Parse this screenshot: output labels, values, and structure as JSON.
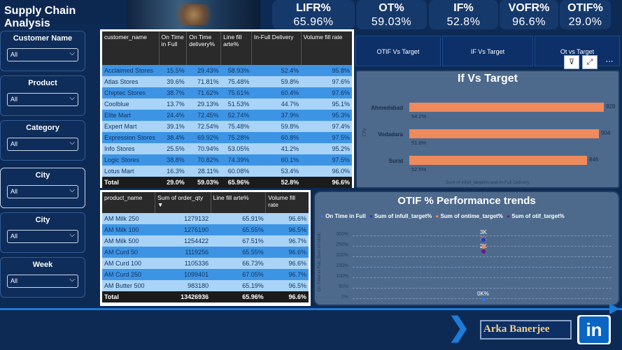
{
  "header": {
    "title": "Supply Chain Analysis"
  },
  "kpis": [
    {
      "label": "LIFR%",
      "value": "65.96%"
    },
    {
      "label": "OT%",
      "value": "59.03%"
    },
    {
      "label": "IF%",
      "value": "52.8%"
    },
    {
      "label": "VOFR%",
      "value": "96.6%"
    },
    {
      "label": "OTIF%",
      "value": "29.0%"
    }
  ],
  "slicers": [
    {
      "label": "Customer Name",
      "value": "All"
    },
    {
      "label": "Product",
      "value": "All"
    },
    {
      "label": "Category",
      "value": "All"
    },
    {
      "label": "City",
      "value": "All"
    },
    {
      "label": "City",
      "value": "All"
    },
    {
      "label": "Week",
      "value": "All"
    }
  ],
  "customer_table": {
    "headers": [
      "customer_name",
      "On Time in Full",
      "On Time delivery%",
      "Line fill arte%",
      "In-Full Delivery",
      "Volume fill rate"
    ],
    "rows": [
      [
        "Acclaimed Stores",
        "15.5%",
        "29.43%",
        "58.93%",
        "52.4%",
        "95.8%"
      ],
      [
        "Atlas Stores",
        "39.6%",
        "71.81%",
        "75.48%",
        "59.8%",
        "97.6%"
      ],
      [
        "Chiptec Stores",
        "38.7%",
        "71.62%",
        "75.61%",
        "60.4%",
        "97.6%"
      ],
      [
        "Coolblue",
        "13.7%",
        "29.13%",
        "51.53%",
        "44.7%",
        "95.1%"
      ],
      [
        "Elite Mart",
        "24.4%",
        "72.45%",
        "52.74%",
        "37.9%",
        "95.3%"
      ],
      [
        "Expert Mart",
        "39.1%",
        "72.54%",
        "75.48%",
        "59.8%",
        "97.4%"
      ],
      [
        "Expression Stores",
        "38.4%",
        "69.92%",
        "75.28%",
        "60.8%",
        "97.5%"
      ],
      [
        "Info Stores",
        "25.5%",
        "70.94%",
        "53.05%",
        "41.2%",
        "95.2%"
      ],
      [
        "Logic Stores",
        "38.8%",
        "70.82%",
        "74.39%",
        "60.1%",
        "97.5%"
      ],
      [
        "Lotus Mart",
        "16.3%",
        "28.11%",
        "60.08%",
        "53.4%",
        "96.0%"
      ]
    ],
    "total": [
      "Total",
      "29.0%",
      "59.03%",
      "65.96%",
      "52.8%",
      "96.6%"
    ]
  },
  "product_table": {
    "headers": [
      "product_name",
      "Sum of order_qty",
      "Line fill arte%",
      "Volume fill rate"
    ],
    "rows": [
      [
        "AM Milk 250",
        "1279132",
        "65.91%",
        "96.6%"
      ],
      [
        "AM Milk 100",
        "1276190",
        "65.55%",
        "96.5%"
      ],
      [
        "AM Milk 500",
        "1254422",
        "67.51%",
        "96.7%"
      ],
      [
        "AM Curd 50",
        "1119256",
        "65.55%",
        "96.6%"
      ],
      [
        "AM Curd 100",
        "1105336",
        "66.73%",
        "96.6%"
      ],
      [
        "AM Curd 250",
        "1099401",
        "67.05%",
        "96.7%"
      ],
      [
        "AM Butter 500",
        "983180",
        "65.19%",
        "96.5%"
      ]
    ],
    "total": [
      "Total",
      "13426936",
      "65.96%",
      "96.6%"
    ]
  },
  "tabs": [
    {
      "label": "OTIF Vs Target"
    },
    {
      "label": "IF Vs Target"
    },
    {
      "label": "Ot vs Target"
    }
  ],
  "if_chart": {
    "title": "If Vs Target",
    "xlabel": "Sum of infull_target% and In-Full Delivery",
    "ylabel": "City"
  },
  "otif_chart": {
    "title": "OTIF % Performance trends",
    "legend": [
      "On Time in Full",
      "Sum of infull_target%",
      "Sum of ontime_target%",
      "Sum of otif_target%"
    ],
    "yticks": [
      "300%",
      "250%",
      "200%",
      "150%",
      "100%",
      "50%",
      "0%"
    ],
    "ylabel": "On Time in Full, Sum of infull...",
    "point_labels": [
      "3K",
      "3K",
      "2K",
      "0K%"
    ]
  },
  "chart_data": [
    {
      "type": "bar",
      "title": "If Vs Target",
      "categories": [
        "Ahmedabad",
        "Vodadara",
        "Surat"
      ],
      "series": [
        {
          "name": "infull_target%",
          "values": [
            928,
            904,
            846
          ]
        },
        {
          "name": "In-Full Delivery",
          "values": [
            "54.2%",
            "51.6%",
            "52.5%"
          ]
        }
      ],
      "xlabel": "Sum of infull_target% and In-Full Delivery",
      "ylabel": "City"
    },
    {
      "type": "scatter",
      "title": "OTIF % Performance trends",
      "series": [
        {
          "name": "On Time in Full",
          "values": [
            "0K%"
          ]
        },
        {
          "name": "Sum of infull_target%",
          "values": [
            "3K"
          ]
        },
        {
          "name": "Sum of ontime_target%",
          "values": [
            "3K"
          ]
        },
        {
          "name": "Sum of otif_target%",
          "values": [
            "2K"
          ]
        }
      ],
      "yticks": [
        "0%",
        "50%",
        "100%",
        "150%",
        "200%",
        "250%",
        "300%"
      ]
    }
  ],
  "colors": {
    "background": "#0d2a55",
    "kpi_box": "#16396b",
    "bar": "#ef8a5c",
    "row_a": "#3d94e4",
    "row_b": "#a9d4f7",
    "legend": [
      "#2f7ee6",
      "#1f3fbf",
      "#ef8a5c",
      "#6a1a8a"
    ]
  },
  "footer": {
    "author": "Arka Banerjee",
    "linkedin_icon": "in"
  },
  "icons": [
    "chevron-down-icon",
    "filter-icon",
    "focus-mode-icon",
    "more-options-icon",
    "sort-desc-icon",
    "chevron-right-arrow-icon",
    "linkedin-icon"
  ]
}
